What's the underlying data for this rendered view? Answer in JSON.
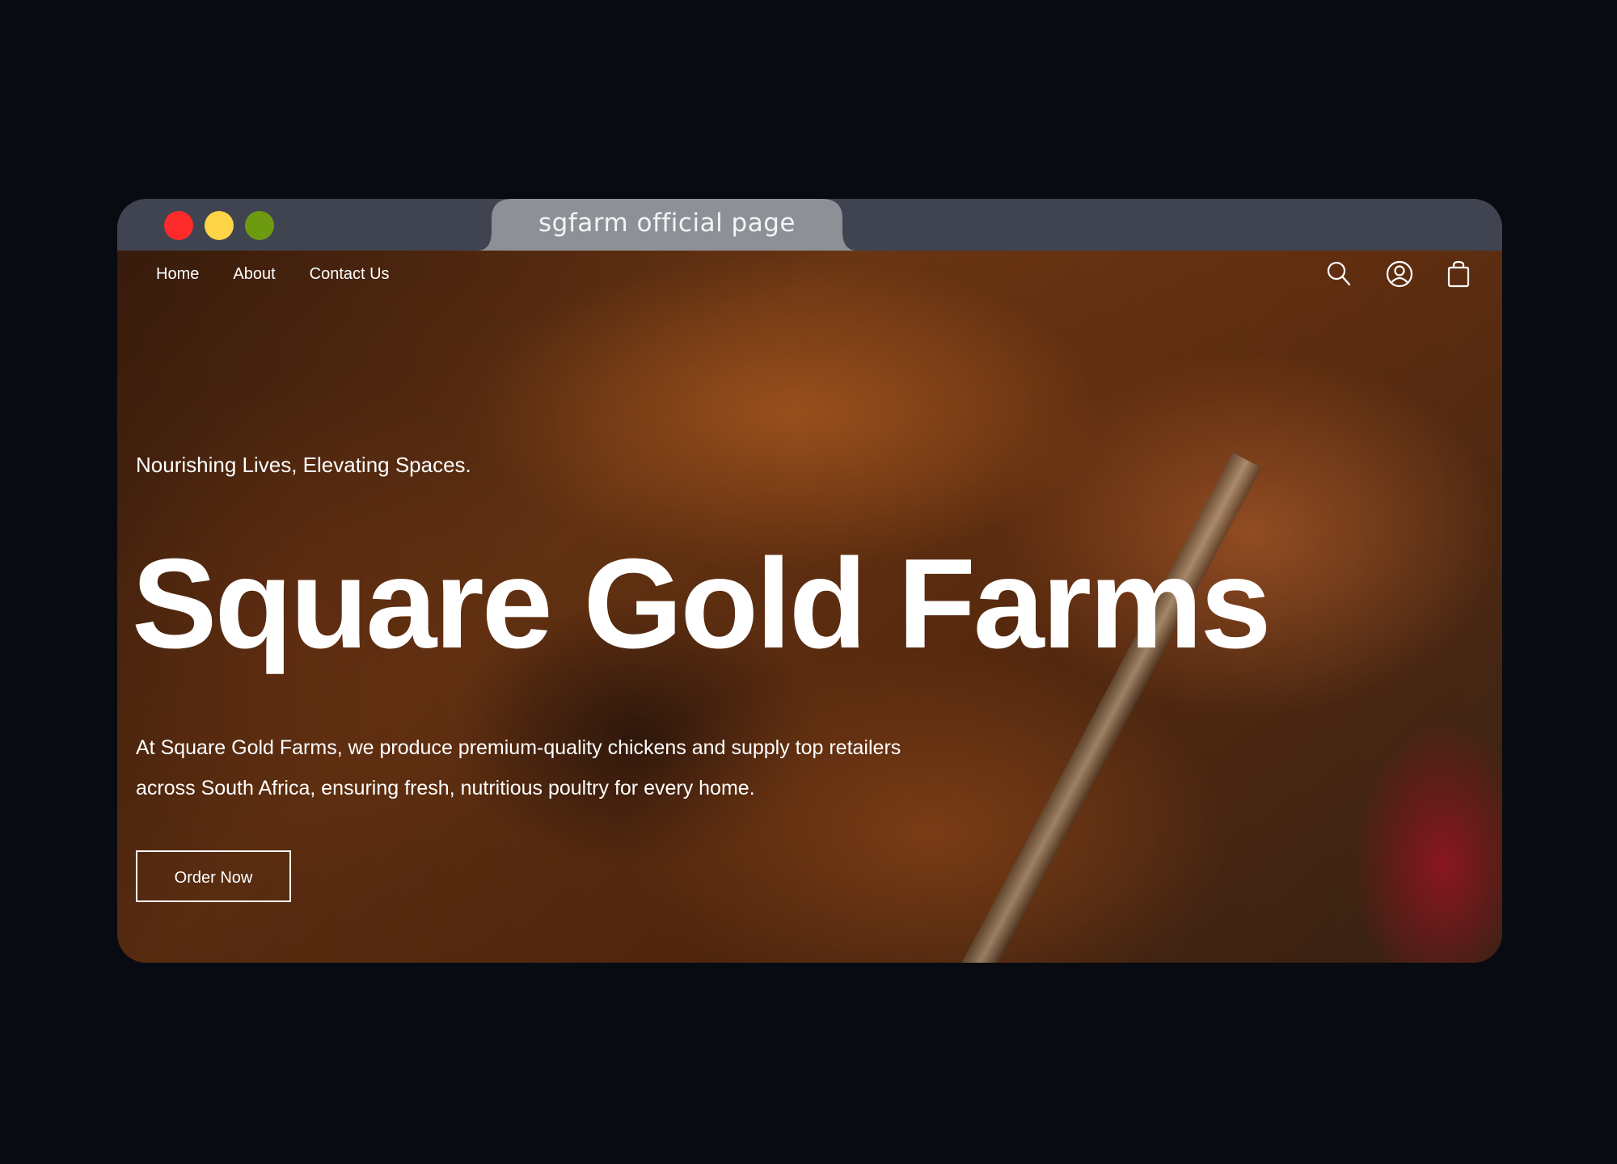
{
  "window": {
    "tab_title": "sgfarm official page",
    "controls": {
      "close_color": "#ff2b2b",
      "minimize_color": "#ffd447",
      "maximize_color": "#6e9a12"
    }
  },
  "nav": {
    "items": [
      {
        "label": "Home"
      },
      {
        "label": "About"
      },
      {
        "label": "Contact Us"
      }
    ]
  },
  "header_icons": [
    "search-icon",
    "account-icon",
    "shopping-bag-icon"
  ],
  "hero": {
    "tagline": "Nourishing Lives, Elevating Spaces.",
    "headline": "Square Gold Farms",
    "description": "At Square Gold Farms, we produce premium-quality chickens and supply top retailers across South Africa, ensuring fresh, nutritious poultry for every home.",
    "cta_label": "Order Now"
  }
}
